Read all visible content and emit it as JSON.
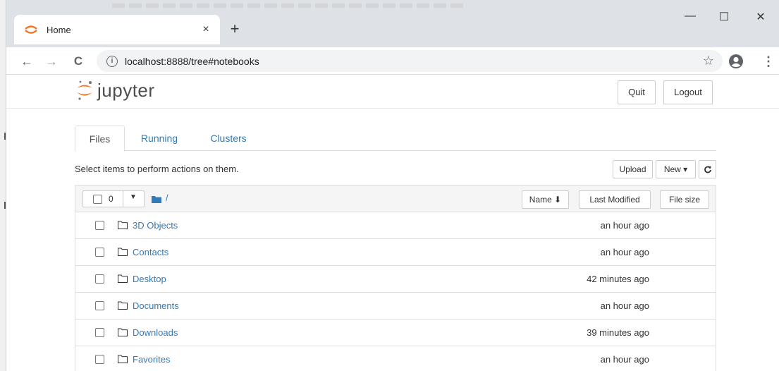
{
  "browser": {
    "tab_title": "Home",
    "tab_close": "×",
    "new_tab": "+",
    "window_controls": {
      "minimize": "—",
      "maximize": "☐",
      "close": "✕"
    },
    "nav": {
      "back": "←",
      "forward": "→",
      "reload": "C"
    },
    "url": "localhost:8888/tree#notebooks",
    "info_icon": "i",
    "star_icon": "☆",
    "menu_icon": "⋮"
  },
  "header": {
    "logo_text": "jupyter",
    "quit_label": "Quit",
    "logout_label": "Logout"
  },
  "tabs": [
    {
      "label": "Files",
      "active": true
    },
    {
      "label": "Running",
      "active": false
    },
    {
      "label": "Clusters",
      "active": false
    }
  ],
  "toolbar": {
    "select_message": "Select items to perform actions on them.",
    "upload_label": "Upload",
    "new_label": "New ▾",
    "refresh_icon": "refresh-icon"
  },
  "list_header": {
    "selected_count": "0",
    "path": "/",
    "name_label": "Name ⬇",
    "last_modified_label": "Last Modified",
    "file_size_label": "File size"
  },
  "items": [
    {
      "name": "3D Objects",
      "modified": "an hour ago"
    },
    {
      "name": "Contacts",
      "modified": "an hour ago"
    },
    {
      "name": "Desktop",
      "modified": "42 minutes ago"
    },
    {
      "name": "Documents",
      "modified": "an hour ago"
    },
    {
      "name": "Downloads",
      "modified": "39 minutes ago"
    },
    {
      "name": "Favorites",
      "modified": "an hour ago"
    }
  ],
  "colors": {
    "link": "#337ab7",
    "jupyter_orange": "#f37726",
    "chrome_bg": "#dee1e6"
  }
}
